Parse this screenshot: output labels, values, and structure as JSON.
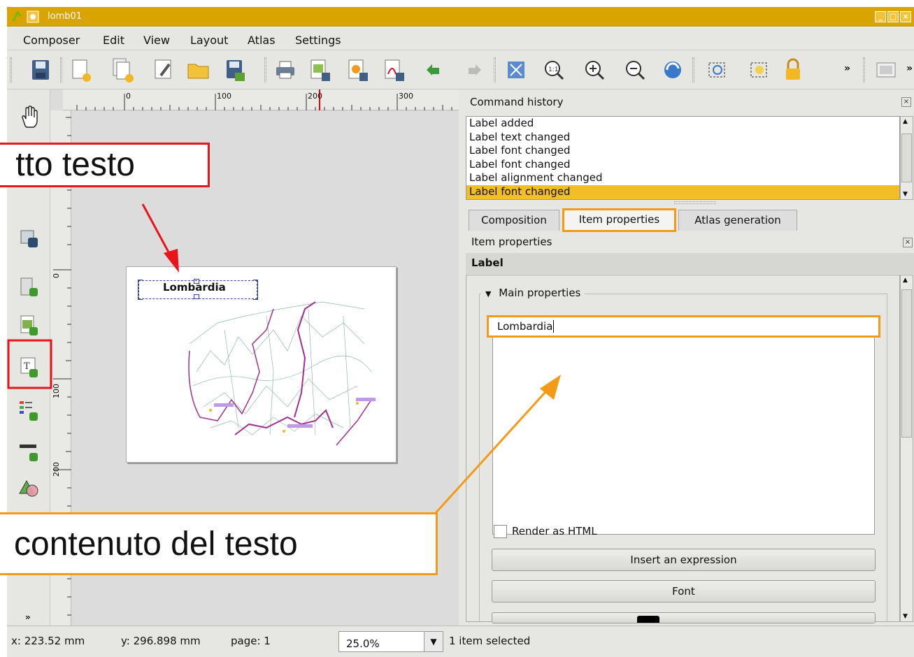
{
  "window": {
    "title": "lomb01"
  },
  "menu": [
    "Composer",
    "Edit",
    "View",
    "Layout",
    "Atlas",
    "Settings"
  ],
  "ruler": {
    "h_ticks": [
      "0",
      "100",
      "200",
      "300"
    ],
    "v_ticks": [
      "0",
      "100",
      "200"
    ]
  },
  "canvas": {
    "label_text": "Lombardia"
  },
  "command_history": {
    "title": "Command history",
    "items": [
      "Label added",
      "Label text changed",
      "Label font changed",
      "Label font changed",
      "Label alignment changed",
      "Label font changed"
    ],
    "selected_index": 5
  },
  "tabs": [
    "Composition",
    "Item properties",
    "Atlas generation"
  ],
  "item_props": {
    "title": "Item properties",
    "section": "Label",
    "group": "Main properties",
    "text_value": "Lombardia",
    "render_html": "Render as HTML",
    "insert_expr": "Insert an expression",
    "font_btn": "Font"
  },
  "status": {
    "x": "x: 223.52 mm",
    "y": "y: 296.898 mm",
    "page": "page: 1",
    "zoom": "25.0%",
    "selection": "1 item selected"
  },
  "callouts": {
    "top": "tto testo",
    "bottom": "contenuto del testo"
  },
  "colors": {
    "titlebar": "#d9a300",
    "highlight": "#f39b17",
    "callout_red": "#e8151b",
    "selection": "#f2bd26"
  }
}
